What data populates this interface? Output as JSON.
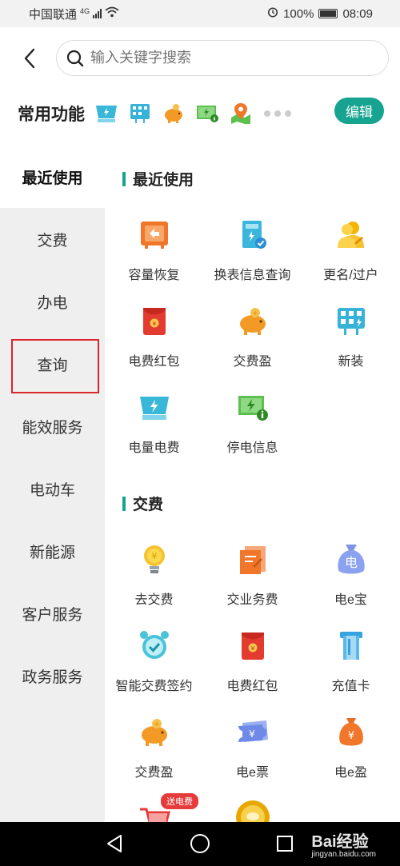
{
  "status_bar": {
    "carrier": "中国联通",
    "network": "4G",
    "battery": "100%",
    "time": "08:09"
  },
  "search": {
    "placeholder": "输入关键字搜索"
  },
  "common_functions": {
    "title": "常用功能",
    "icons": [
      "power-meter-icon",
      "new-install-icon",
      "piggy-bank-icon",
      "outage-info-icon",
      "map-pin-icon"
    ],
    "edit_label": "编辑"
  },
  "sidebar": {
    "items": [
      {
        "label": "最近使用",
        "active": true
      },
      {
        "label": "交费",
        "active": false
      },
      {
        "label": "办电",
        "active": false
      },
      {
        "label": "查询",
        "active": false
      },
      {
        "label": "能效服务",
        "active": false
      },
      {
        "label": "电动车",
        "active": false
      },
      {
        "label": "新能源",
        "active": false
      },
      {
        "label": "客户服务",
        "active": false
      },
      {
        "label": "政务服务",
        "active": false
      }
    ]
  },
  "sections": {
    "recent": {
      "title": "最近使用",
      "items": [
        {
          "label": "容量恢复",
          "icon": "capacity-restore-icon"
        },
        {
          "label": "换表信息查询",
          "icon": "meter-query-icon"
        },
        {
          "label": "更名/过户",
          "icon": "rename-transfer-icon"
        },
        {
          "label": "电费红包",
          "icon": "red-envelope-icon"
        },
        {
          "label": "交费盈",
          "icon": "piggy-bank-icon"
        },
        {
          "label": "新装",
          "icon": "new-install-icon"
        },
        {
          "label": "电量电费",
          "icon": "power-meter-icon"
        },
        {
          "label": "停电信息",
          "icon": "outage-info-icon"
        }
      ]
    },
    "payment": {
      "title": "交费",
      "items": [
        {
          "label": "去交费",
          "icon": "lightbulb-icon"
        },
        {
          "label": "交业务费",
          "icon": "business-fee-icon"
        },
        {
          "label": "电e宝",
          "icon": "money-bag-icon"
        },
        {
          "label": "智能交费签约",
          "icon": "alarm-clock-icon"
        },
        {
          "label": "电费红包",
          "icon": "red-envelope-icon"
        },
        {
          "label": "充值卡",
          "icon": "recharge-card-icon"
        },
        {
          "label": "交费盈",
          "icon": "piggy-bank-icon"
        },
        {
          "label": "电e票",
          "icon": "ticket-icon"
        },
        {
          "label": "电e盈",
          "icon": "coin-bag-icon"
        }
      ],
      "badge": "送电费"
    }
  },
  "watermark": {
    "brand": "Bai经验",
    "url": "jingyan.baidu.com"
  }
}
